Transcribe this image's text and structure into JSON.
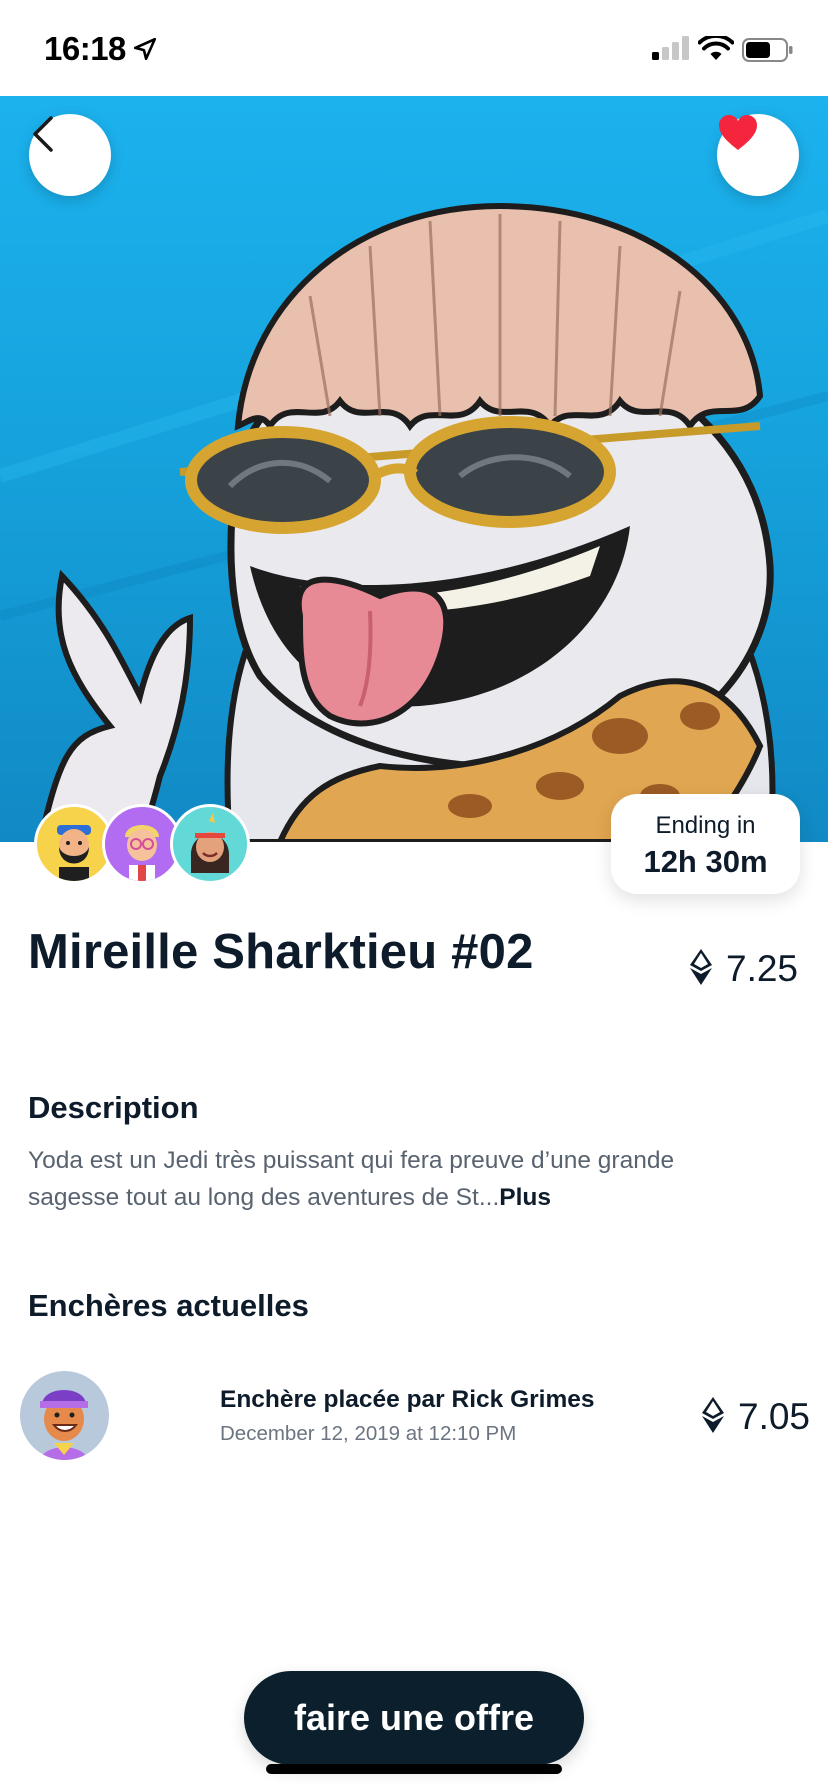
{
  "status_bar": {
    "time": "16:18",
    "icons": [
      "location-arrow-icon",
      "cellular-signal-icon",
      "wifi-icon",
      "battery-icon"
    ]
  },
  "hero": {
    "image_subject": "cartoon shark with bowl haircut and round sunglasses",
    "background_color": "#18a9e6",
    "back_icon": "chevron-left-icon",
    "favorite_icon": "heart-icon",
    "favorite_color": "#f4253d"
  },
  "owners": {
    "avatars": [
      "bearded-man-avatar",
      "blonde-glasses-avatar",
      "headband-woman-avatar"
    ],
    "colors": [
      "#f6d34a",
      "#b26cf2",
      "#62d9d6"
    ]
  },
  "auction": {
    "ending_label": "Ending in",
    "ending_value": "12h 30m"
  },
  "item": {
    "title": "Mireille Sharktieu #02",
    "price": "7.25",
    "currency_icon": "ethereum-icon"
  },
  "description": {
    "heading": "Description",
    "text": "Yoda est un Jedi très puissant qui fera preuve d’une grande sagesse tout au long des aventures de St...",
    "more_label": "Plus"
  },
  "bids": {
    "heading": "Enchères actuelles",
    "items": [
      {
        "title": "Enchère placée par Rick Grimes",
        "date": "December 12, 2019 at 12:10 PM",
        "price": "7.05",
        "avatar": "cap-man-avatar"
      }
    ]
  },
  "cta": {
    "label": "faire une offre",
    "color": "#0b1f2c"
  }
}
